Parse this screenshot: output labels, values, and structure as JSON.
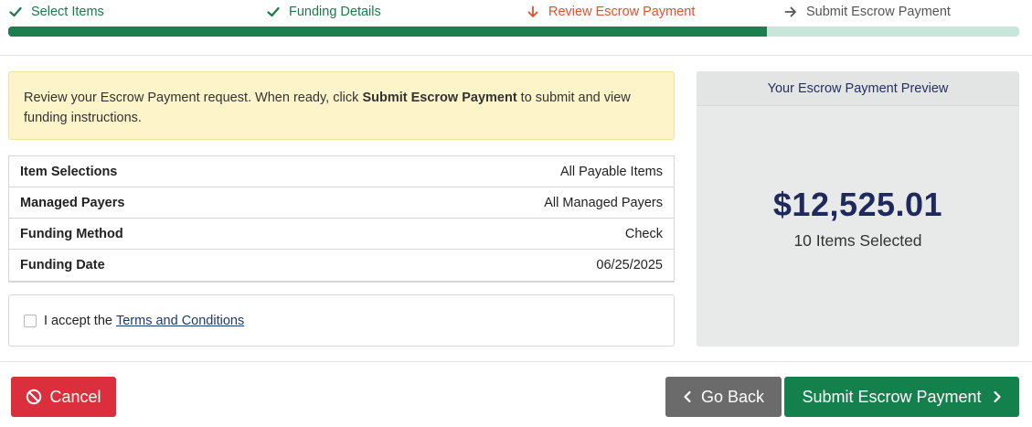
{
  "stepper": {
    "steps": [
      {
        "label": "Select Items",
        "state": "done"
      },
      {
        "label": "Funding Details",
        "state": "done"
      },
      {
        "label": "Review Escrow Payment",
        "state": "current"
      },
      {
        "label": "Submit Escrow Payment",
        "state": "todo"
      }
    ],
    "progress_fraction": 0.75
  },
  "alert": {
    "text_before": "Review your Escrow Payment request. When ready, click ",
    "bold": "Submit Escrow Payment",
    "text_after": " to submit and view funding instructions."
  },
  "details": [
    {
      "label": "Item Selections",
      "value": "All Payable Items"
    },
    {
      "label": "Managed Payers",
      "value": "All Managed Payers"
    },
    {
      "label": "Funding Method",
      "value": "Check"
    },
    {
      "label": "Funding Date",
      "value": "06/25/2025"
    }
  ],
  "terms": {
    "prefix": "I accept the",
    "link": "Terms and Conditions",
    "checked": false
  },
  "preview": {
    "title": "Your Escrow Payment Preview",
    "amount": "$12,525.01",
    "items_selected": "10 Items Selected"
  },
  "buttons": {
    "cancel": "Cancel",
    "back": "Go Back",
    "submit": "Submit Escrow Payment"
  },
  "colors": {
    "done": "#1a7a4a",
    "current": "#e0522b",
    "progress_fill": "#1b7f4e",
    "progress_track": "#c9e6da",
    "cancel": "#dc2f3e",
    "back": "#6b6b6b",
    "submit": "#14814d"
  },
  "icons": {
    "done": "check-icon",
    "current": "arrow-down-icon",
    "todo": "arrow-right-icon",
    "cancel": "ban-icon",
    "back": "chevron-left-icon",
    "submit": "chevron-right-icon"
  }
}
